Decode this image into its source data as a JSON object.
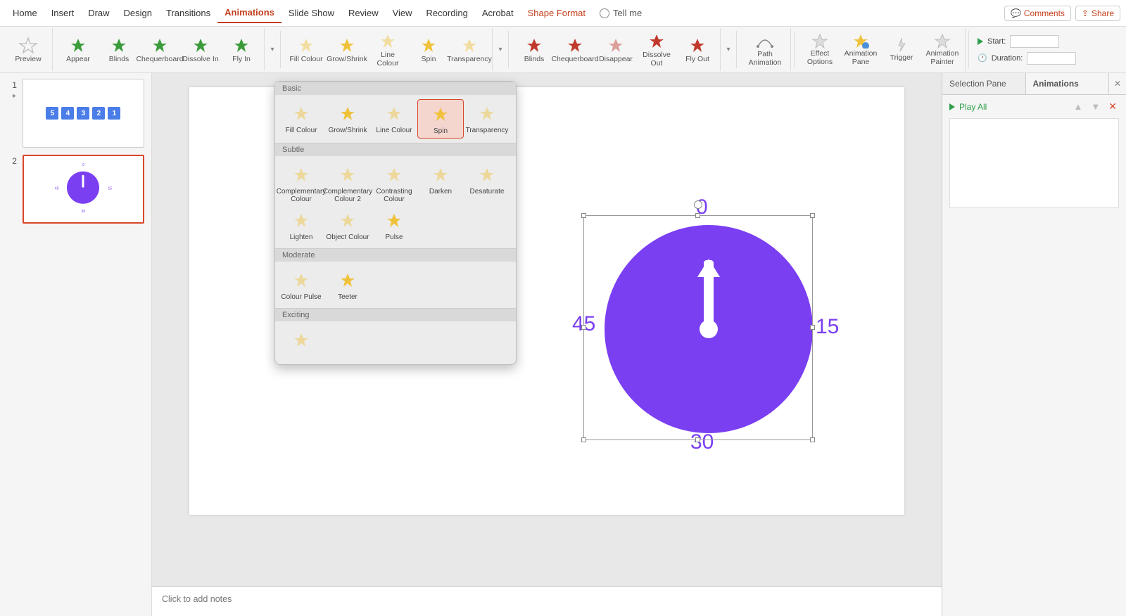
{
  "ribbon": {
    "tabs": [
      "Home",
      "Insert",
      "Draw",
      "Design",
      "Transitions",
      "Animations",
      "Slide Show",
      "Review",
      "View",
      "Recording",
      "Acrobat",
      "Shape Format"
    ],
    "active": "Animations",
    "shape_tab": "Shape Format",
    "tell_me": "Tell me",
    "comments": "Comments",
    "share": "Share"
  },
  "toolbar": {
    "preview": "Preview",
    "entrance": [
      {
        "label": "Appear",
        "color": "green"
      },
      {
        "label": "Blinds",
        "color": "green"
      },
      {
        "label": "Chequerboard",
        "color": "green"
      },
      {
        "label": "Dissolve In",
        "color": "green"
      },
      {
        "label": "Fly In",
        "color": "green"
      }
    ],
    "emphasis": [
      {
        "label": "Fill Colour",
        "color": "yellow",
        "faded": true
      },
      {
        "label": "Grow/Shrink",
        "color": "yellow"
      },
      {
        "label": "Line Colour",
        "color": "yellow",
        "faded": true
      },
      {
        "label": "Spin",
        "color": "yellow"
      },
      {
        "label": "Transparency",
        "color": "yellow",
        "faded": true
      }
    ],
    "exit": [
      {
        "label": "Blinds",
        "color": "red"
      },
      {
        "label": "Chequerboard",
        "color": "red"
      },
      {
        "label": "Disappear",
        "color": "red",
        "faded": true
      },
      {
        "label": "Dissolve Out",
        "color": "red"
      },
      {
        "label": "Fly Out",
        "color": "red"
      }
    ],
    "path_anim": "Path Animation",
    "effect_opts": "Effect Options",
    "anim_pane": "Animation Pane",
    "trigger": "Trigger",
    "anim_painter": "Animation Painter",
    "start": "Start:",
    "duration": "Duration:"
  },
  "dropdown": {
    "sections": {
      "basic": {
        "title": "Basic",
        "items": [
          "Fill Colour",
          "Grow/Shrink",
          "Line Colour",
          "Spin",
          "Transparency"
        ],
        "selected": "Spin"
      },
      "subtle": {
        "title": "Subtle",
        "items": [
          "Complementary Colour",
          "Complementary Colour 2",
          "Contrasting Colour",
          "Darken",
          "Desaturate",
          "Lighten",
          "Object Colour",
          "Pulse"
        ]
      },
      "moderate": {
        "title": "Moderate",
        "items": [
          "Colour Pulse",
          "Teeter"
        ]
      },
      "exciting": {
        "title": "Exciting",
        "items": [
          ""
        ]
      }
    }
  },
  "slides": {
    "numbers": [
      "1",
      "2"
    ],
    "thumb1_boxes": [
      "5",
      "4",
      "3",
      "2",
      "1"
    ],
    "thumb2_nums": {
      "top": "0",
      "right": "15",
      "bottom": "30",
      "left": "45"
    }
  },
  "canvas": {
    "clock_nums": {
      "top": "0",
      "right": "15",
      "bottom": "30",
      "left": "45"
    }
  },
  "notes_placeholder": "Click to add notes",
  "right": {
    "tab_selection": "Selection Pane",
    "tab_anims": "Animations",
    "play_all": "Play All"
  }
}
